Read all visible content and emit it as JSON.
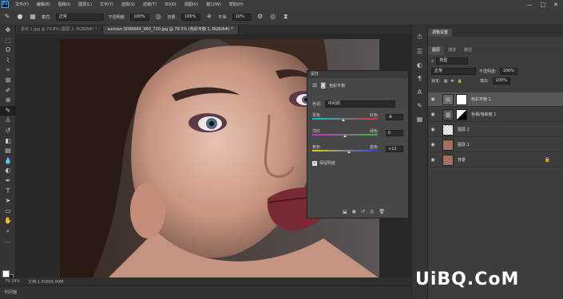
{
  "menubar": {
    "logo": "Ps",
    "items": [
      "文件(F)",
      "编辑(E)",
      "图像(I)",
      "图层(L)",
      "文字(Y)",
      "选择(S)",
      "滤镜(T)",
      "3D(D)",
      "视图(V)",
      "窗口(W)",
      "帮助(H)"
    ],
    "controls": [
      "—",
      "□",
      "✕"
    ]
  },
  "options": {
    "mode_label": "模式:",
    "mode_value": "正常",
    "opacity_label": "不透明度:",
    "opacity_value": "100%",
    "flow_label": "流量:",
    "flow_value": "100%",
    "smooth_label": "平滑:",
    "smooth_value": "10%"
  },
  "tabs": [
    "素材 1.jpg @ 79.8% (图层 2, RGB/8#) *",
    "woman-3096664_960_720.jpg @ 79.3% (色彩平衡 1, RGB/8#) *"
  ],
  "status": {
    "zoom": "79.34%",
    "doc": "文档:1.91M/6.99M"
  },
  "timeline_label": "时间轴",
  "properties": {
    "title": "属性",
    "adj_name": "色彩平衡",
    "tone_label": "色调:",
    "tone_value": "中间调",
    "sliders": [
      {
        "left": "青色",
        "right": "红色",
        "value": "-6",
        "pos": 0.47
      },
      {
        "left": "洋红",
        "right": "绿色",
        "value": "0",
        "pos": 0.5
      },
      {
        "left": "黄色",
        "right": "蓝色",
        "value": "+12",
        "pos": 0.56
      }
    ],
    "preserve_label": "保留明度"
  },
  "layers": {
    "top_tabs": [
      "调整设置"
    ],
    "tabs": [
      "图层",
      "通道",
      "路径"
    ],
    "kind": "类型",
    "blend": "正常",
    "opacity_label": "不透明度:",
    "opacity_value": "100%",
    "lock_label": "锁定:",
    "fill_label": "填充:",
    "fill_value": "100%",
    "items": [
      {
        "name": "色彩平衡 1",
        "type": "adjustment",
        "selected": true
      },
      {
        "name": "色相/饱和度 1",
        "type": "adjustment-mask",
        "selected": false
      },
      {
        "name": "图层 2",
        "type": "transparent",
        "selected": false
      },
      {
        "name": "图层 1",
        "type": "photo",
        "selected": false
      },
      {
        "name": "背景",
        "type": "photo",
        "selected": false
      }
    ]
  },
  "watermark": "UiBQ.CoM",
  "colors": {
    "accent": "#31a8ff",
    "panel": "#474747",
    "selected_row": "#575757"
  }
}
